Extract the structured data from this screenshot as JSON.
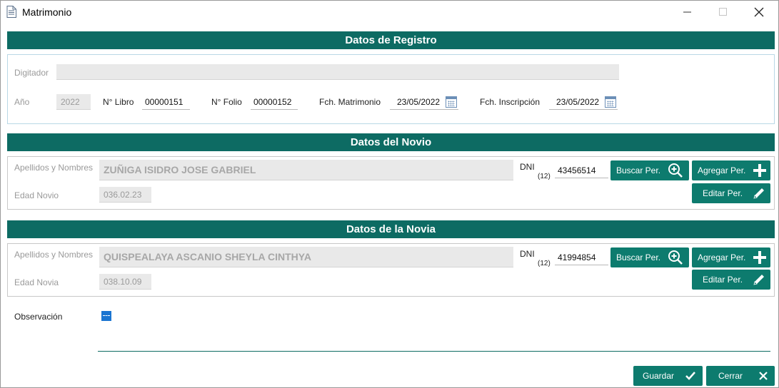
{
  "window": {
    "title": "Matrimonio",
    "icon": "document-icon"
  },
  "registro": {
    "header": "Datos de Registro",
    "digitador_label": "Digitador",
    "digitador_value": "",
    "anio_label": "Año",
    "anio_value": "2022",
    "libro_label": "N° Libro",
    "libro_value": "00000151",
    "folio_label": "N° Folio",
    "folio_value": "00000152",
    "fch_matrimonio_label": "Fch. Matrimonio",
    "fch_matrimonio_value": "23/05/2022",
    "fch_inscripcion_label": "Fch. Inscripción",
    "fch_inscripcion_value": "23/05/2022"
  },
  "novio": {
    "header": "Datos del Novio",
    "nombres_label": "Apellidos y Nombres",
    "nombres_value": "ZUÑIGA ISIDRO JOSE GABRIEL",
    "dni_label": "DNI",
    "dni_len": "(12)",
    "dni_value": "43456514",
    "edad_label": "Edad Novio",
    "edad_value": "036.02.23",
    "buscar_label": "Buscar Per.",
    "agregar_label": "Agregar Per.",
    "editar_label": "Editar Per."
  },
  "novia": {
    "header": "Datos de la Novia",
    "nombres_label": "Apellidos y Nombres",
    "nombres_value": "QUISPEALAYA ASCANIO SHEYLA CINTHYA",
    "dni_label": "DNI",
    "dni_len": "(12)",
    "dni_value": "41994854",
    "edad_label": "Edad Novia",
    "edad_value": "038.10.09",
    "buscar_label": "Buscar Per.",
    "agregar_label": "Agregar Per.",
    "editar_label": "Editar Per."
  },
  "observacion": {
    "label": "Observación",
    "value": ""
  },
  "footer": {
    "guardar_label": "Guardar",
    "cerrar_label": "Cerrar"
  },
  "colors": {
    "accent": "#0d6b63",
    "button": "#0d7b6e",
    "checkbox": "#1b75d1"
  }
}
